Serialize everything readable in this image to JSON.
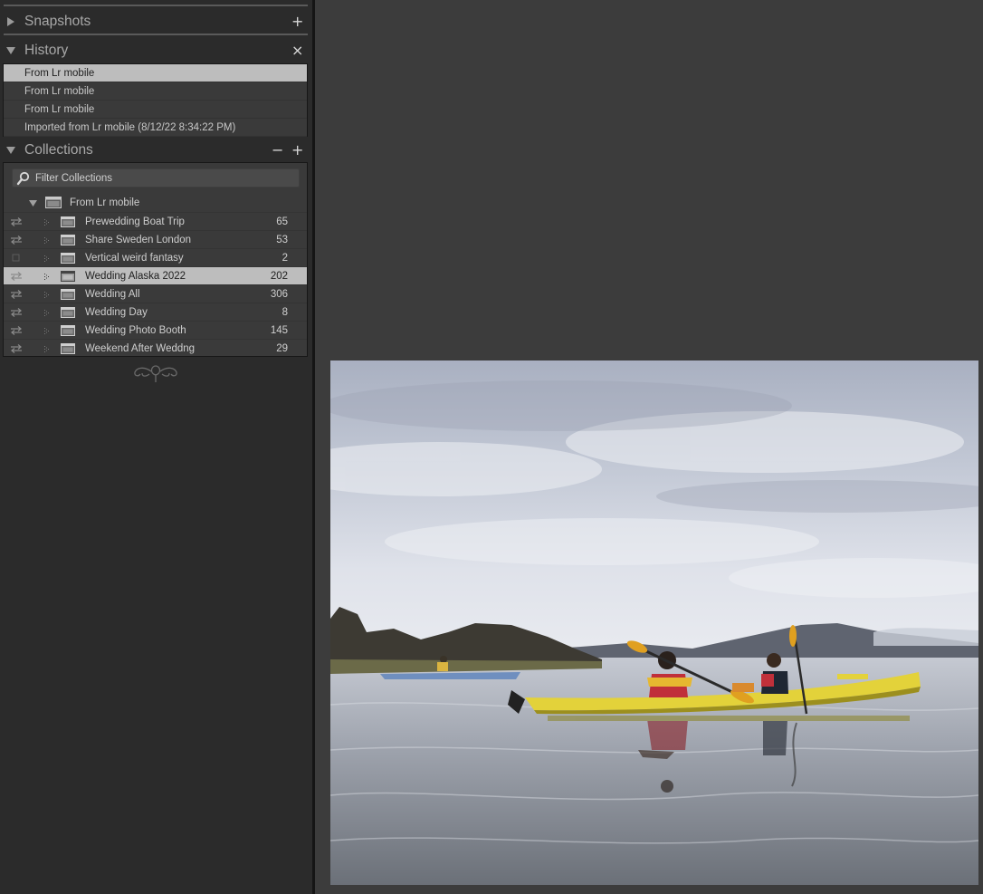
{
  "snapshots": {
    "title": "Snapshots",
    "add_icon": "+"
  },
  "history": {
    "title": "History",
    "clear_icon": "×",
    "items": [
      {
        "label": "From Lr mobile",
        "selected": true
      },
      {
        "label": "From Lr mobile",
        "selected": false
      },
      {
        "label": "From Lr mobile",
        "selected": false
      },
      {
        "label": "Imported from Lr mobile (8/12/22 8:34:22 PM)",
        "selected": false
      }
    ]
  },
  "collections": {
    "title": "Collections",
    "remove_icon": "−",
    "add_icon": "+",
    "filter_placeholder": "Filter Collections",
    "set_name": "From Lr mobile",
    "items": [
      {
        "name": "Prewedding Boat Trip",
        "count": "65",
        "synced": true,
        "selected": false
      },
      {
        "name": "Share Sweden London",
        "count": "53",
        "synced": true,
        "selected": false
      },
      {
        "name": "Vertical weird fantasy",
        "count": "2",
        "synced": false,
        "selected": false
      },
      {
        "name": "Wedding Alaska 2022",
        "count": "202",
        "synced": true,
        "selected": true
      },
      {
        "name": "Wedding All",
        "count": "306",
        "synced": true,
        "selected": false
      },
      {
        "name": "Wedding Day",
        "count": "8",
        "synced": true,
        "selected": false
      },
      {
        "name": "Wedding Photo Booth",
        "count": "145",
        "synced": true,
        "selected": false
      },
      {
        "name": "Weekend After Weddng",
        "count": "29",
        "synced": true,
        "selected": false
      }
    ]
  },
  "colors": {
    "panel_bg": "#2b2b2b",
    "main_bg": "#3c3c3c",
    "selected_row": "#bdbdbd",
    "kayak_yellow": "#e3d23a"
  },
  "photo": {
    "subject": "kayak-photo"
  }
}
